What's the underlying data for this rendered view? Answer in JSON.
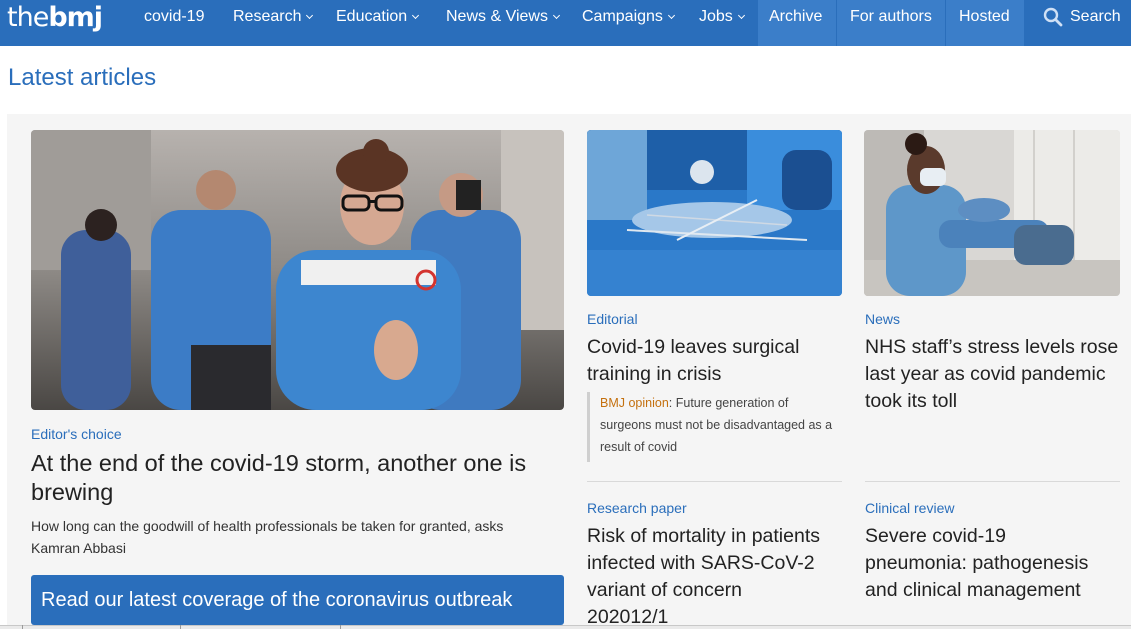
{
  "brand": {
    "logo_part1": "the",
    "logo_part2": "bmj"
  },
  "nav": {
    "items": [
      {
        "label": "covid-19",
        "dropdown": false
      },
      {
        "label": "Research",
        "dropdown": true
      },
      {
        "label": "Education",
        "dropdown": true
      },
      {
        "label": "News & Views",
        "dropdown": true
      },
      {
        "label": "Campaigns",
        "dropdown": true
      },
      {
        "label": "Jobs",
        "dropdown": true
      }
    ],
    "links": [
      {
        "label": "Archive"
      },
      {
        "label": "For authors"
      },
      {
        "label": "Hosted"
      }
    ],
    "search_label": "Search"
  },
  "section_title": "Latest articles",
  "featured": {
    "kicker": "Editor's choice",
    "headline_line1": "At the end of the covid-19 storm, another one is",
    "headline_line2": "brewing",
    "standfirst_line1": "How long can the goodwill of health professionals be taken for granted, asks",
    "standfirst_line2": "Kamran Abbasi"
  },
  "cta": {
    "label": "Read our latest coverage of the coronavirus outbreak"
  },
  "articles": [
    {
      "kicker": "Editorial",
      "headline_line1": "Covid-19 leaves surgical",
      "headline_line2": "training in crisis",
      "opinion_label": "BMJ opinion",
      "opinion_text_line1": ": Future generation of",
      "opinion_text_line2": "surgeons must not be disadvantaged as a",
      "opinion_text_line3": "result of covid"
    },
    {
      "kicker": "News",
      "headline_line1": "NHS staff’s stress levels rose",
      "headline_line2": "last year as covid pandemic",
      "headline_line3": "took its toll"
    },
    {
      "kicker": "Research paper",
      "headline_line1": "Risk of mortality in patients",
      "headline_line2": "infected with SARS-CoV-2",
      "headline_line3": "variant of concern",
      "headline_line4": "202012/1"
    },
    {
      "kicker": "Clinical review",
      "headline_line1": "Severe covid-19",
      "headline_line2": "pneumonia: pathogenesis",
      "headline_line3": "and clinical management"
    }
  ],
  "colors": {
    "brand_blue": "#2a6ebb",
    "nav_highlight": "#3b7ec9",
    "opinion_orange": "#c4700e"
  }
}
